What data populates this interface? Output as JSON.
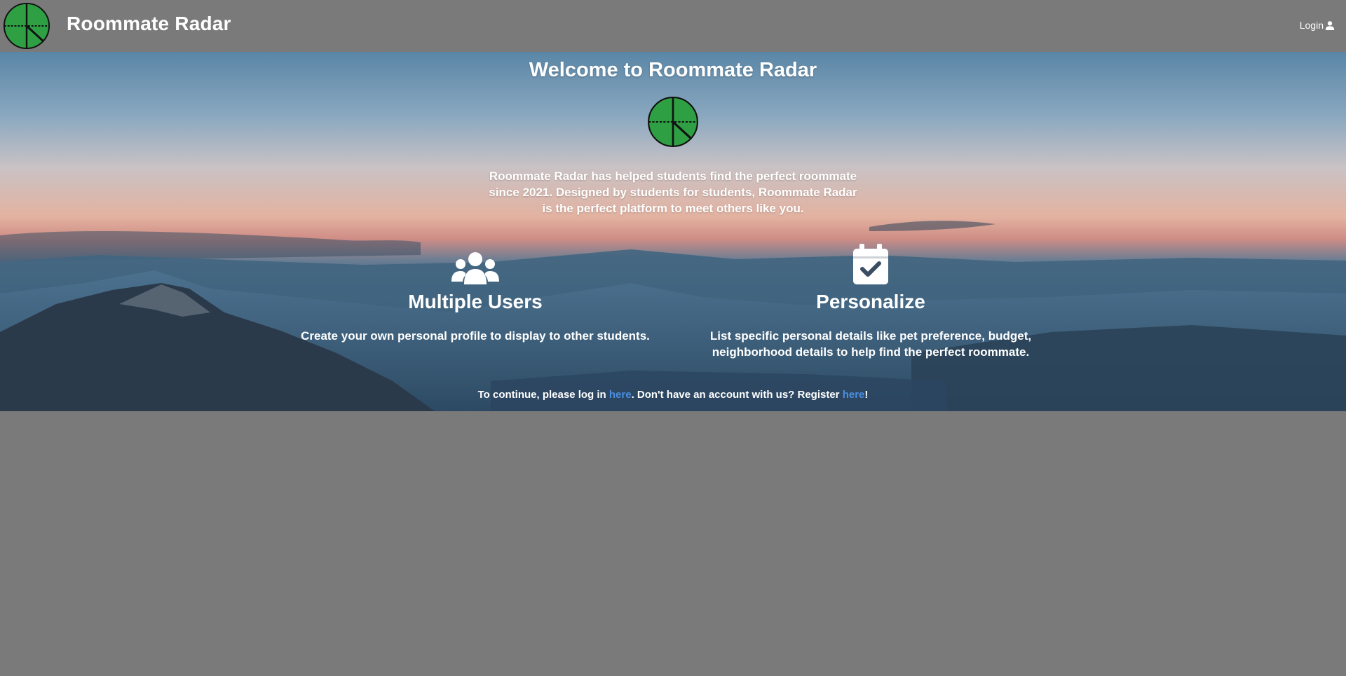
{
  "nav": {
    "brand": "Roommate Radar",
    "login_label": "Login"
  },
  "hero": {
    "title": "Welcome to Roommate Radar",
    "intro": "Roommate Radar has helped students find the perfect roommate since 2021. Designed by students for students, Roommate Radar is the perfect platform to meet others like you."
  },
  "features": [
    {
      "icon": "users-icon",
      "title": "Multiple Users",
      "description": "Create your own personal profile to display to other students."
    },
    {
      "icon": "calendar-check-icon",
      "title": "Personalize",
      "description": "List specific personal details like pet preference, budget, neighborhood details to help find the perfect roommate."
    }
  ],
  "footer": {
    "prefix": "To continue, please log in ",
    "login_link": "here",
    "middle": ". Don't have an account with us? Register ",
    "register_link": "here",
    "suffix": "!"
  },
  "colors": {
    "background": "#7a7a7a",
    "logo_green": "#2ea043",
    "link": "#4a8fe0"
  }
}
